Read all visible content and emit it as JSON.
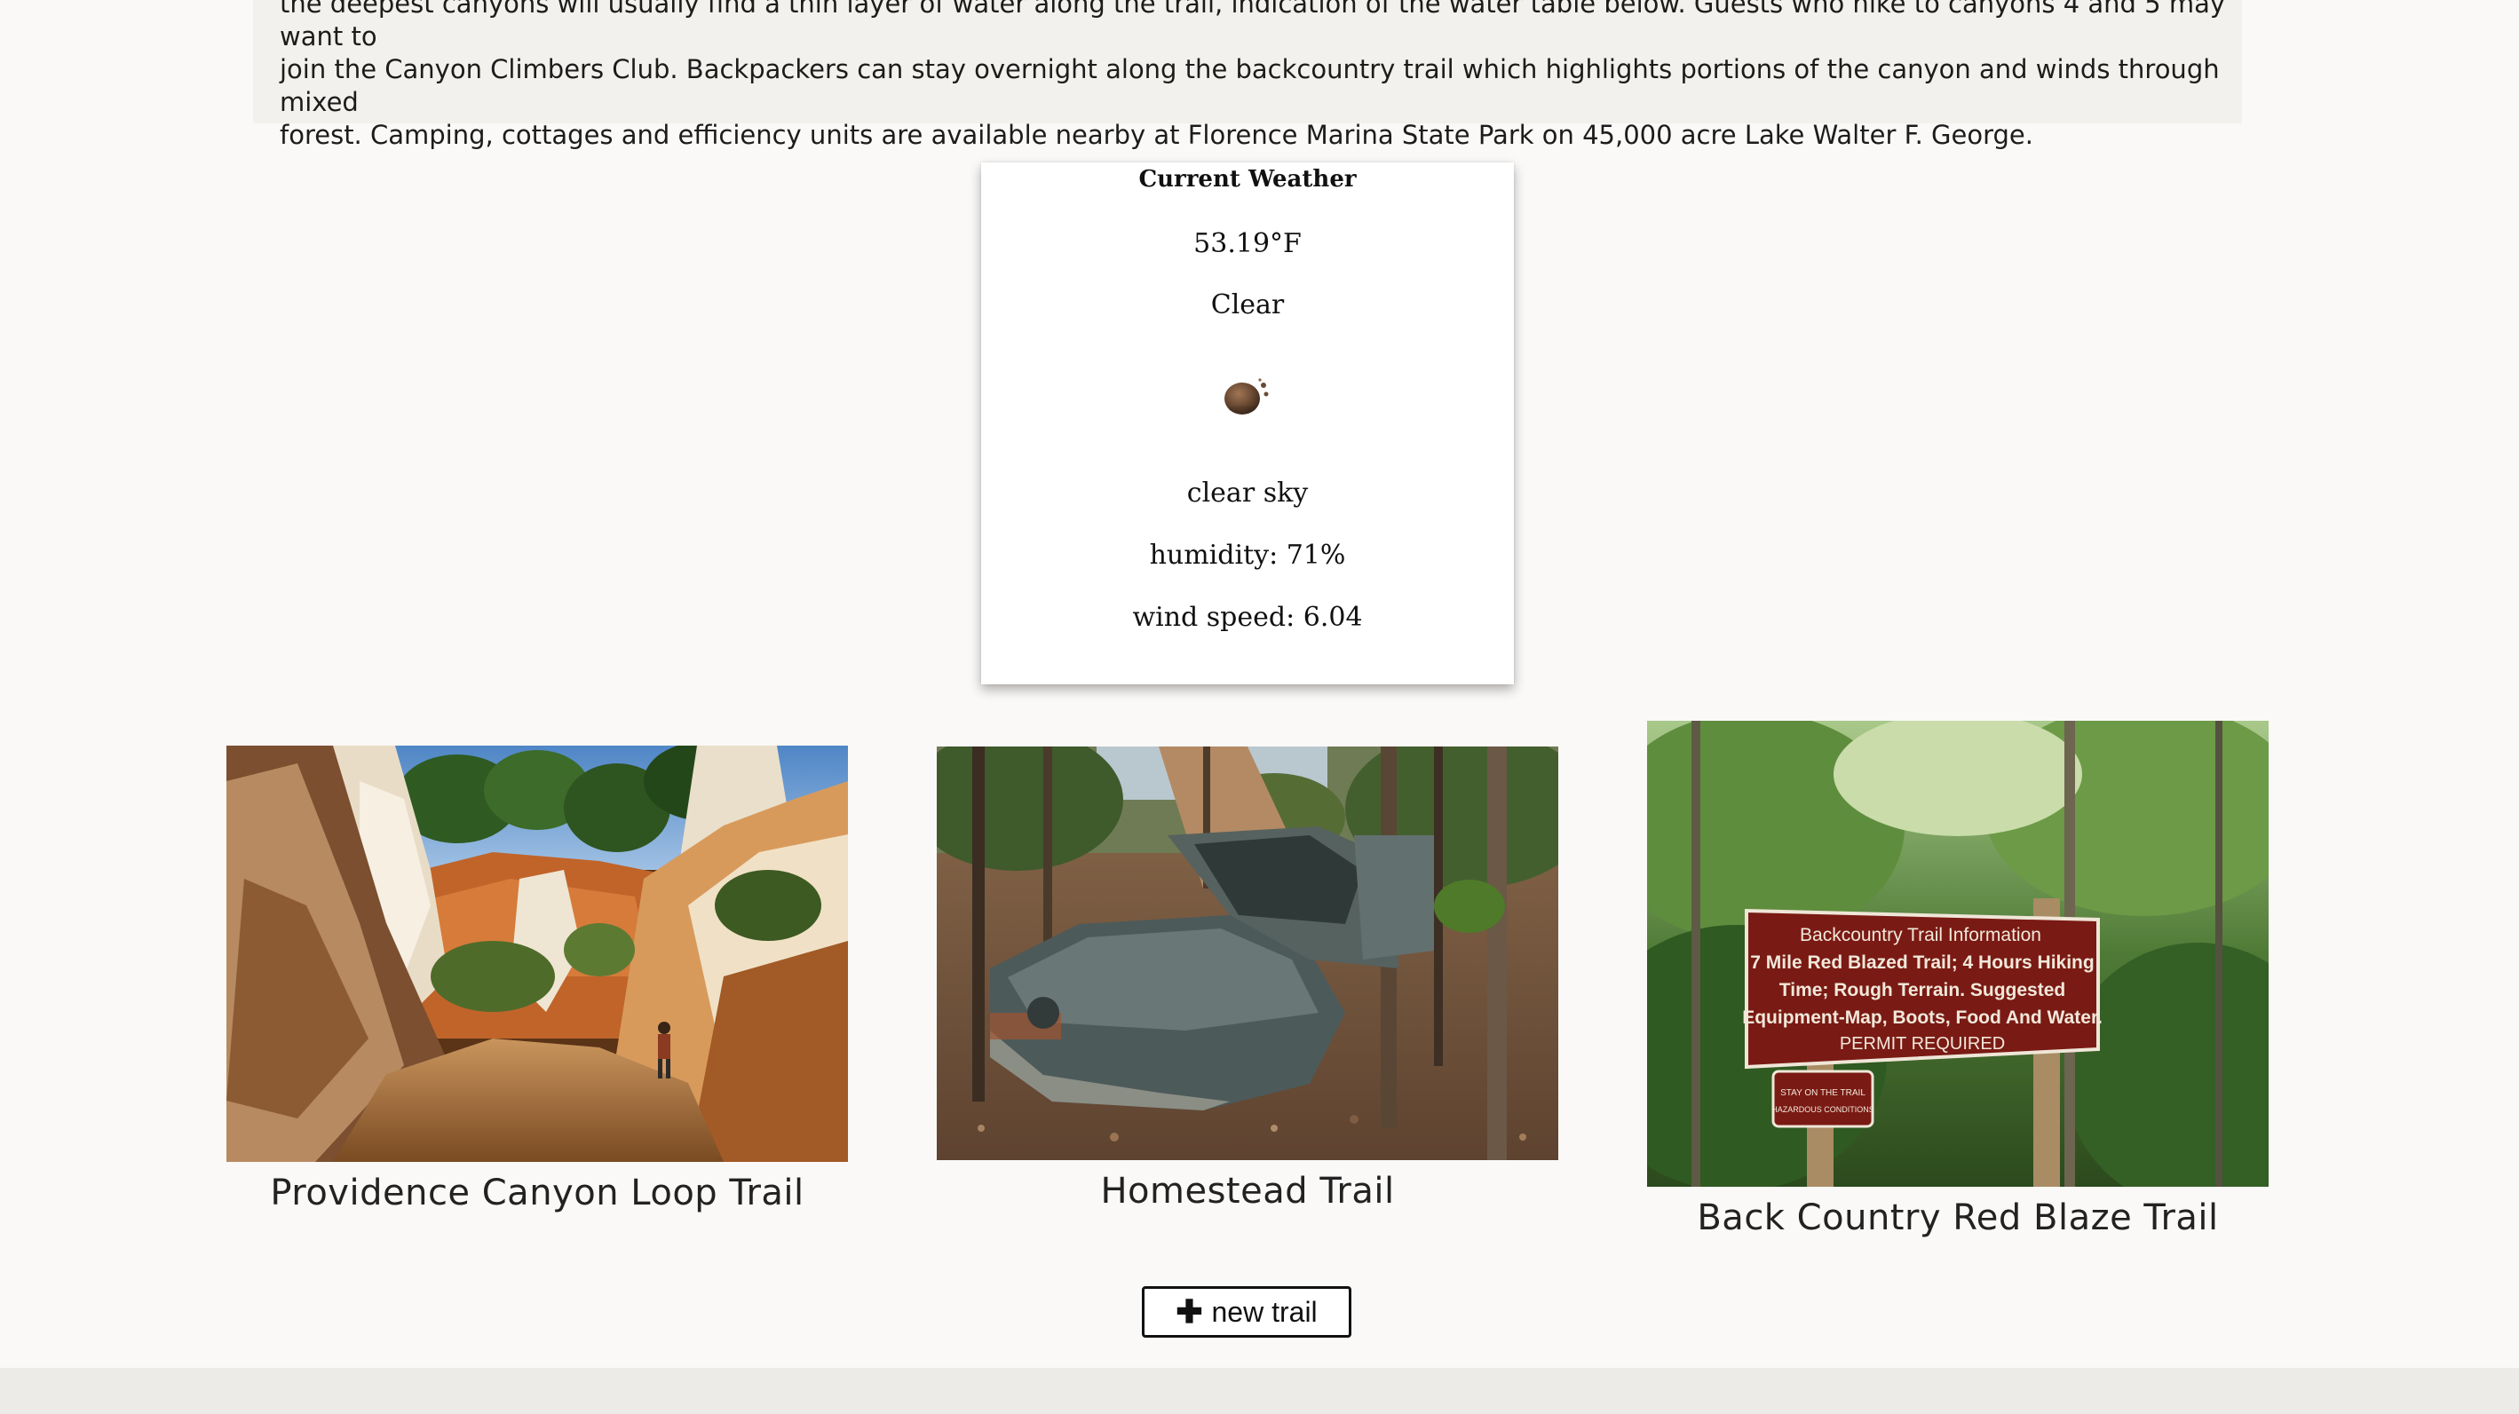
{
  "park": {
    "description": "the deepest canyons will usually find a thin layer of water along the trail, indication of the water table below. Guests who hike to canyons 4 and 5 may want to\njoin the Canyon Climbers Club. Backpackers can stay overnight along the backcountry trail which highlights portions of the canyon and winds through mixed\nforest. Camping, cottages and efficiency units are available nearby at Florence Marina State Park on 45,000 acre Lake Walter F. George."
  },
  "weather": {
    "heading": "Current Weather",
    "temperature": "53.19°F",
    "condition": "Clear",
    "icon": "clear-night-icon",
    "description": "clear sky",
    "humidity": "humidity: 71%",
    "wind_speed": "wind speed: 6.04"
  },
  "trails": [
    {
      "name": "Providence Canyon Loop Trail",
      "image": "canyon-photo"
    },
    {
      "name": "Homestead Trail",
      "image": "abandoned-car-photo"
    },
    {
      "name": "Back Country Red Blaze Trail",
      "image": "trail-sign-photo"
    }
  ],
  "trail_sign": {
    "title": "Backcountry Trail Information",
    "line1": "7 Mile Red Blazed Trail; 4 Hours Hiking",
    "line2": "Time; Rough Terrain. Suggested",
    "line3": "Equipment-Map, Boots, Food And Water.",
    "line4": "PERMIT REQUIRED",
    "small1": "STAY ON THE TRAIL",
    "small2": "HAZARDOUS CONDITIONS"
  },
  "actions": {
    "new_trail_icon": "plus-icon",
    "new_trail_label": "new trail"
  },
  "colors": {
    "page_background": "#faf9f7",
    "description_background": "#f2f1ed",
    "card_background": "#ffffff",
    "footer_background": "#edebe8"
  }
}
